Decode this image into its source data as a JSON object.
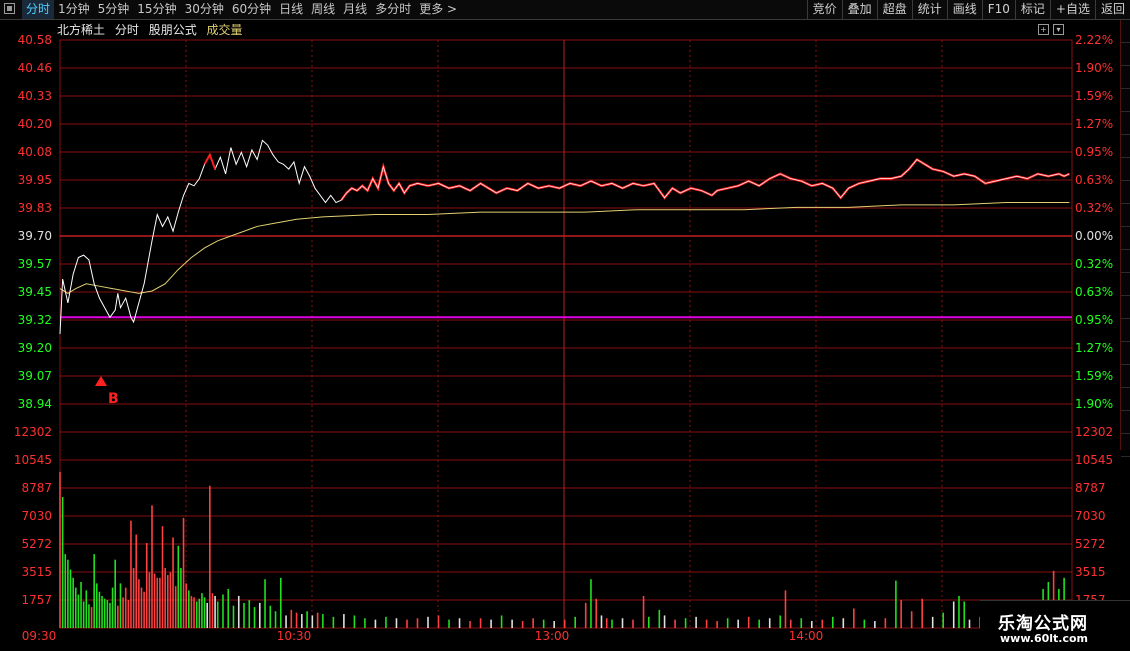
{
  "toolbar": {
    "tabs": [
      "分时",
      "1分钟",
      "5分钟",
      "15分钟",
      "30分钟",
      "60分钟",
      "日线",
      "周线",
      "月线",
      "多分时",
      "更多 >"
    ],
    "active_tab": 0,
    "tools": [
      "竞价",
      "叠加",
      "超盘",
      "统计",
      "画线",
      "F10",
      "标记",
      "+自选",
      "返回"
    ]
  },
  "infobar": {
    "stock_name": "北方稀土",
    "mode": "分时",
    "formula": "股朋公式",
    "volume_label": "成交量"
  },
  "controls": [
    "+",
    "▾"
  ],
  "marker": {
    "label": "B",
    "color": "#ff2020"
  },
  "watermark": {
    "line1": "乐淘公式网",
    "line2": "www.60lt.com"
  },
  "colors": {
    "up": "#ff3030",
    "down": "#20ff20",
    "neutral": "#e0e0e0",
    "grid": "#8a1010",
    "price_line": "#ffffff",
    "price_line_above": "#ff2020",
    "avg_line": "#e0d070",
    "support_line": "#e000e0",
    "vol_up": "#ff4040",
    "vol_down": "#20e020",
    "vol_flat": "#e0e0e0"
  },
  "chart_data": {
    "type": "line",
    "prev_close": 39.7,
    "price_axis_left": [
      "40.58",
      "40.46",
      "40.33",
      "40.20",
      "40.08",
      "39.95",
      "39.83",
      "39.70",
      "39.57",
      "39.45",
      "39.32",
      "39.20",
      "39.07",
      "38.94"
    ],
    "price_axis_right": [
      "2.22%",
      "1.90%",
      "1.59%",
      "1.27%",
      "0.95%",
      "0.63%",
      "0.32%",
      "0.00%",
      "0.32%",
      "0.63%",
      "0.95%",
      "1.27%",
      "1.59%",
      "1.90%"
    ],
    "ylim": [
      38.94,
      40.58
    ],
    "volume_axis": [
      "12302",
      "10545",
      "8787",
      "7030",
      "5272",
      "3515",
      "1757"
    ],
    "volume_ylim": [
      0,
      14059
    ],
    "time_labels": [
      "09:30",
      "10:30",
      "13:00",
      "14:00"
    ],
    "support_level": 39.42,
    "price": [
      [
        0,
        39.35
      ],
      [
        1,
        39.58
      ],
      [
        3,
        39.48
      ],
      [
        5,
        39.6
      ],
      [
        7,
        39.67
      ],
      [
        9,
        39.68
      ],
      [
        11,
        39.66
      ],
      [
        13,
        39.56
      ],
      [
        15,
        39.5
      ],
      [
        17,
        39.46
      ],
      [
        19,
        39.42
      ],
      [
        21,
        39.45
      ],
      [
        22,
        39.52
      ],
      [
        23,
        39.46
      ],
      [
        25,
        39.5
      ],
      [
        27,
        39.42
      ],
      [
        28,
        39.4
      ],
      [
        30,
        39.48
      ],
      [
        32,
        39.56
      ],
      [
        35,
        39.74
      ],
      [
        37,
        39.85
      ],
      [
        39,
        39.8
      ],
      [
        41,
        39.84
      ],
      [
        43,
        39.78
      ],
      [
        45,
        39.86
      ],
      [
        47,
        39.93
      ],
      [
        49,
        39.98
      ],
      [
        51,
        39.97
      ],
      [
        53,
        40.0
      ],
      [
        55,
        40.06
      ],
      [
        57,
        40.1
      ],
      [
        59,
        40.04
      ],
      [
        61,
        40.09
      ],
      [
        63,
        40.02
      ],
      [
        65,
        40.13
      ],
      [
        67,
        40.06
      ],
      [
        69,
        40.11
      ],
      [
        71,
        40.05
      ],
      [
        73,
        40.12
      ],
      [
        75,
        40.08
      ],
      [
        77,
        40.16
      ],
      [
        79,
        40.14
      ],
      [
        81,
        40.1
      ],
      [
        83,
        40.07
      ],
      [
        85,
        40.06
      ],
      [
        87,
        40.04
      ],
      [
        89,
        40.07
      ],
      [
        91,
        39.98
      ],
      [
        93,
        40.05
      ],
      [
        95,
        40.01
      ],
      [
        97,
        39.96
      ],
      [
        99,
        39.93
      ],
      [
        101,
        39.9
      ],
      [
        103,
        39.93
      ],
      [
        105,
        39.9
      ],
      [
        107,
        39.91
      ],
      [
        109,
        39.94
      ],
      [
        111,
        39.96
      ],
      [
        113,
        39.95
      ],
      [
        115,
        39.97
      ],
      [
        117,
        39.95
      ],
      [
        119,
        40.0
      ],
      [
        121,
        39.96
      ],
      [
        123,
        40.05
      ],
      [
        125,
        39.98
      ],
      [
        127,
        39.95
      ],
      [
        129,
        39.98
      ],
      [
        131,
        39.94
      ],
      [
        133,
        39.97
      ],
      [
        136,
        39.98
      ],
      [
        140,
        39.97
      ],
      [
        144,
        39.98
      ],
      [
        148,
        39.96
      ],
      [
        152,
        39.97
      ],
      [
        156,
        39.95
      ],
      [
        160,
        39.98
      ],
      [
        163,
        39.96
      ],
      [
        166,
        39.94
      ],
      [
        170,
        39.96
      ],
      [
        174,
        39.95
      ],
      [
        178,
        39.98
      ],
      [
        182,
        39.96
      ],
      [
        186,
        39.97
      ],
      [
        190,
        39.96
      ],
      [
        194,
        39.98
      ],
      [
        198,
        39.97
      ],
      [
        202,
        39.99
      ],
      [
        206,
        39.97
      ],
      [
        210,
        39.98
      ],
      [
        214,
        39.96
      ],
      [
        218,
        39.98
      ],
      [
        222,
        39.97
      ],
      [
        226,
        39.98
      ],
      [
        228,
        39.95
      ],
      [
        230,
        39.92
      ],
      [
        233,
        39.96
      ],
      [
        236,
        39.94
      ],
      [
        240,
        39.96
      ],
      [
        244,
        39.95
      ],
      [
        248,
        39.93
      ],
      [
        250,
        39.95
      ],
      [
        254,
        39.96
      ],
      [
        258,
        39.97
      ],
      [
        262,
        39.99
      ],
      [
        266,
        39.97
      ],
      [
        270,
        40.0
      ],
      [
        274,
        40.02
      ],
      [
        278,
        40.0
      ],
      [
        282,
        39.99
      ],
      [
        286,
        39.97
      ],
      [
        290,
        39.98
      ],
      [
        294,
        39.96
      ],
      [
        297,
        39.92
      ],
      [
        300,
        39.96
      ],
      [
        304,
        39.98
      ],
      [
        308,
        39.99
      ],
      [
        312,
        40.0
      ],
      [
        316,
        40.0
      ],
      [
        320,
        40.01
      ],
      [
        323,
        40.04
      ],
      [
        326,
        40.08
      ],
      [
        329,
        40.06
      ],
      [
        332,
        40.04
      ],
      [
        336,
        40.03
      ],
      [
        340,
        40.01
      ],
      [
        344,
        40.02
      ],
      [
        348,
        40.01
      ],
      [
        352,
        39.98
      ],
      [
        356,
        39.99
      ],
      [
        360,
        40.0
      ],
      [
        364,
        40.01
      ],
      [
        368,
        40.0
      ],
      [
        372,
        40.02
      ],
      [
        376,
        40.01
      ],
      [
        380,
        40.02
      ],
      [
        382,
        40.01
      ],
      [
        384,
        40.02
      ]
    ],
    "avg": [
      [
        0,
        39.54
      ],
      [
        3,
        39.52
      ],
      [
        6,
        39.54
      ],
      [
        10,
        39.56
      ],
      [
        15,
        39.55
      ],
      [
        20,
        39.54
      ],
      [
        25,
        39.53
      ],
      [
        30,
        39.52
      ],
      [
        35,
        39.53
      ],
      [
        40,
        39.56
      ],
      [
        45,
        39.62
      ],
      [
        50,
        39.67
      ],
      [
        55,
        39.71
      ],
      [
        60,
        39.74
      ],
      [
        65,
        39.76
      ],
      [
        70,
        39.78
      ],
      [
        75,
        39.8
      ],
      [
        80,
        39.81
      ],
      [
        90,
        39.83
      ],
      [
        100,
        39.84
      ],
      [
        120,
        39.85
      ],
      [
        140,
        39.85
      ],
      [
        160,
        39.86
      ],
      [
        180,
        39.86
      ],
      [
        200,
        39.86
      ],
      [
        220,
        39.87
      ],
      [
        240,
        39.87
      ],
      [
        260,
        39.87
      ],
      [
        280,
        39.88
      ],
      [
        300,
        39.88
      ],
      [
        320,
        39.89
      ],
      [
        340,
        39.89
      ],
      [
        360,
        39.9
      ],
      [
        384,
        39.9
      ]
    ],
    "volume": [
      [
        0,
        11200,
        "up"
      ],
      [
        1,
        9400,
        "down"
      ],
      [
        2,
        5300,
        "down"
      ],
      [
        3,
        4900,
        "down"
      ],
      [
        4,
        4200,
        "down"
      ],
      [
        5,
        3600,
        "down"
      ],
      [
        6,
        2900,
        "down"
      ],
      [
        7,
        2400,
        "down"
      ],
      [
        8,
        3300,
        "down"
      ],
      [
        9,
        1900,
        "down"
      ],
      [
        10,
        2700,
        "down"
      ],
      [
        11,
        1700,
        "down"
      ],
      [
        12,
        1500,
        "up"
      ],
      [
        13,
        5300,
        "down"
      ],
      [
        14,
        3200,
        "down"
      ],
      [
        15,
        2600,
        "down"
      ],
      [
        16,
        2300,
        "down"
      ],
      [
        17,
        2100,
        "down"
      ],
      [
        18,
        2000,
        "down"
      ],
      [
        19,
        1800,
        "down"
      ],
      [
        20,
        2900,
        "down"
      ],
      [
        21,
        4900,
        "down"
      ],
      [
        22,
        1600,
        "up"
      ],
      [
        23,
        3200,
        "down"
      ],
      [
        24,
        2200,
        "up"
      ],
      [
        25,
        2900,
        "up"
      ],
      [
        26,
        2000,
        "up"
      ],
      [
        27,
        7700,
        "up"
      ],
      [
        28,
        4300,
        "up"
      ],
      [
        29,
        6700,
        "up"
      ],
      [
        30,
        3500,
        "up"
      ],
      [
        31,
        2900,
        "up"
      ],
      [
        32,
        2600,
        "up"
      ],
      [
        33,
        6100,
        "up"
      ],
      [
        34,
        4000,
        "up"
      ],
      [
        35,
        8800,
        "up"
      ],
      [
        36,
        3900,
        "up"
      ],
      [
        37,
        3600,
        "up"
      ],
      [
        38,
        3600,
        "up"
      ],
      [
        39,
        7300,
        "up"
      ],
      [
        40,
        4300,
        "up"
      ],
      [
        41,
        3800,
        "up"
      ],
      [
        42,
        4000,
        "up"
      ],
      [
        43,
        6500,
        "up"
      ],
      [
        44,
        3000,
        "up"
      ],
      [
        45,
        5900,
        "down"
      ],
      [
        46,
        4300,
        "down"
      ],
      [
        47,
        7900,
        "up"
      ],
      [
        48,
        3200,
        "up"
      ],
      [
        49,
        2700,
        "down"
      ],
      [
        50,
        2300,
        "up"
      ],
      [
        51,
        2200,
        "up"
      ],
      [
        52,
        1900,
        "down"
      ],
      [
        53,
        2100,
        "down"
      ],
      [
        54,
        2500,
        "down"
      ],
      [
        55,
        2200,
        "down"
      ],
      [
        56,
        1800,
        "flat"
      ],
      [
        57,
        10200,
        "up"
      ],
      [
        58,
        2500,
        "up"
      ],
      [
        59,
        2300,
        "flat"
      ],
      [
        60,
        1900,
        "down"
      ],
      [
        62,
        2400,
        "down"
      ],
      [
        64,
        2800,
        "down"
      ],
      [
        66,
        1600,
        "down"
      ],
      [
        68,
        2300,
        "flat"
      ],
      [
        70,
        1800,
        "down"
      ],
      [
        72,
        2000,
        "down"
      ],
      [
        74,
        1500,
        "down"
      ],
      [
        76,
        1800,
        "flat"
      ],
      [
        78,
        3500,
        "down"
      ],
      [
        80,
        1600,
        "down"
      ],
      [
        82,
        1200,
        "down"
      ],
      [
        84,
        3600,
        "down"
      ],
      [
        86,
        900,
        "flat"
      ],
      [
        88,
        1300,
        "up"
      ],
      [
        90,
        1100,
        "up"
      ],
      [
        92,
        1000,
        "flat"
      ],
      [
        94,
        1200,
        "down"
      ],
      [
        96,
        900,
        "flat"
      ],
      [
        98,
        1100,
        "up"
      ],
      [
        100,
        1000,
        "down"
      ],
      [
        104,
        800,
        "down"
      ],
      [
        108,
        1000,
        "flat"
      ],
      [
        112,
        900,
        "down"
      ],
      [
        116,
        700,
        "down"
      ],
      [
        120,
        600,
        "flat"
      ],
      [
        124,
        800,
        "down"
      ],
      [
        128,
        700,
        "flat"
      ],
      [
        132,
        600,
        "up"
      ],
      [
        136,
        700,
        "up"
      ],
      [
        140,
        800,
        "flat"
      ],
      [
        144,
        900,
        "up"
      ],
      [
        148,
        600,
        "down"
      ],
      [
        152,
        700,
        "flat"
      ],
      [
        156,
        500,
        "up"
      ],
      [
        160,
        700,
        "up"
      ],
      [
        164,
        600,
        "flat"
      ],
      [
        168,
        900,
        "down"
      ],
      [
        172,
        600,
        "flat"
      ],
      [
        176,
        500,
        "up"
      ],
      [
        180,
        700,
        "up"
      ],
      [
        184,
        600,
        "down"
      ],
      [
        188,
        500,
        "flat"
      ],
      [
        192,
        600,
        "up"
      ],
      [
        196,
        800,
        "down"
      ],
      [
        200,
        1800,
        "up"
      ],
      [
        202,
        3500,
        "down"
      ],
      [
        204,
        2100,
        "up"
      ],
      [
        206,
        900,
        "flat"
      ],
      [
        208,
        700,
        "up"
      ],
      [
        210,
        600,
        "down"
      ],
      [
        214,
        700,
        "flat"
      ],
      [
        218,
        600,
        "up"
      ],
      [
        222,
        2300,
        "up"
      ],
      [
        224,
        800,
        "down"
      ],
      [
        228,
        1300,
        "down"
      ],
      [
        230,
        900,
        "flat"
      ],
      [
        234,
        600,
        "up"
      ],
      [
        238,
        700,
        "down"
      ],
      [
        242,
        800,
        "flat"
      ],
      [
        246,
        600,
        "up"
      ],
      [
        250,
        500,
        "up"
      ],
      [
        254,
        700,
        "down"
      ],
      [
        258,
        600,
        "flat"
      ],
      [
        262,
        800,
        "up"
      ],
      [
        266,
        600,
        "down"
      ],
      [
        270,
        700,
        "flat"
      ],
      [
        274,
        900,
        "down"
      ],
      [
        276,
        2700,
        "up"
      ],
      [
        278,
        600,
        "up"
      ],
      [
        282,
        700,
        "down"
      ],
      [
        286,
        500,
        "flat"
      ],
      [
        290,
        600,
        "up"
      ],
      [
        294,
        800,
        "down"
      ],
      [
        298,
        700,
        "flat"
      ],
      [
        302,
        1400,
        "up"
      ],
      [
        306,
        600,
        "down"
      ],
      [
        310,
        500,
        "flat"
      ],
      [
        314,
        700,
        "up"
      ],
      [
        318,
        3400,
        "down"
      ],
      [
        320,
        2000,
        "up"
      ],
      [
        324,
        1200,
        "up"
      ],
      [
        328,
        2100,
        "up"
      ],
      [
        332,
        800,
        "flat"
      ],
      [
        336,
        1100,
        "down"
      ],
      [
        340,
        1900,
        "flat"
      ],
      [
        342,
        2300,
        "down"
      ],
      [
        344,
        1900,
        "down"
      ],
      [
        346,
        600,
        "flat"
      ],
      [
        350,
        800,
        "up"
      ],
      [
        354,
        1400,
        "down"
      ],
      [
        358,
        600,
        "flat"
      ],
      [
        362,
        500,
        "down"
      ],
      [
        366,
        700,
        "flat"
      ],
      [
        370,
        1200,
        "down"
      ],
      [
        372,
        1600,
        "down"
      ],
      [
        374,
        2800,
        "down"
      ],
      [
        376,
        3300,
        "down"
      ],
      [
        378,
        4100,
        "up"
      ],
      [
        380,
        2800,
        "down"
      ],
      [
        382,
        3600,
        "down"
      ]
    ]
  }
}
